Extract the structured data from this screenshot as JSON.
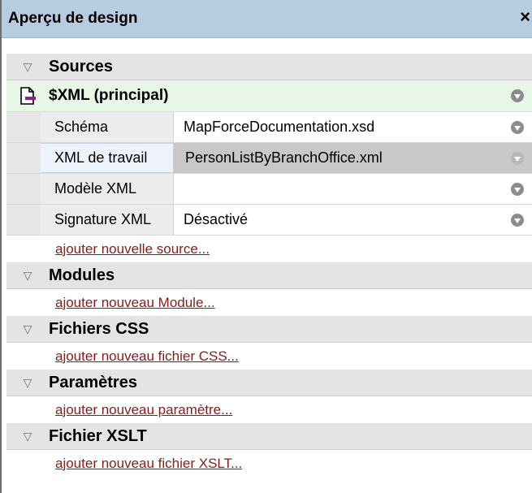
{
  "window": {
    "title": "Aperçu de design",
    "close_glyph": "×"
  },
  "sections": [
    {
      "label": "Sources",
      "expander_icon": "collapse-triangle",
      "source": {
        "label": "$XML (principal)",
        "icon": "xml-document-icon",
        "properties": [
          {
            "key": "Schéma",
            "value": "MapForceDocumentation.xsd"
          },
          {
            "key": "XML de travail",
            "value": "PersonListByBranchOffice.xml"
          },
          {
            "key": "Modèle XML",
            "value": ""
          },
          {
            "key": "Signature XML",
            "value": "Désactivé"
          }
        ]
      },
      "add_link": "ajouter nouvelle source..."
    },
    {
      "label": "Modules",
      "expander_icon": "collapse-triangle",
      "add_link": "ajouter nouveau Module..."
    },
    {
      "label": "Fichiers CSS",
      "expander_icon": "collapse-triangle",
      "add_link": "ajouter nouveau fichier CSS..."
    },
    {
      "label": "Paramètres",
      "expander_icon": "collapse-triangle",
      "add_link": "ajouter nouveau paramètre..."
    },
    {
      "label": "Fichier XSLT",
      "expander_icon": "collapse-triangle",
      "add_link": "ajouter nouveau fichier XSLT..."
    }
  ],
  "colors": {
    "titlebar": "#b7cbe1",
    "section_header": "#e4e4e4",
    "source_row": "#e8f6e8",
    "selected_value": "#c8c8c8",
    "link": "#8b1a1a",
    "xml_icon_accent": "#8e1f8e"
  }
}
